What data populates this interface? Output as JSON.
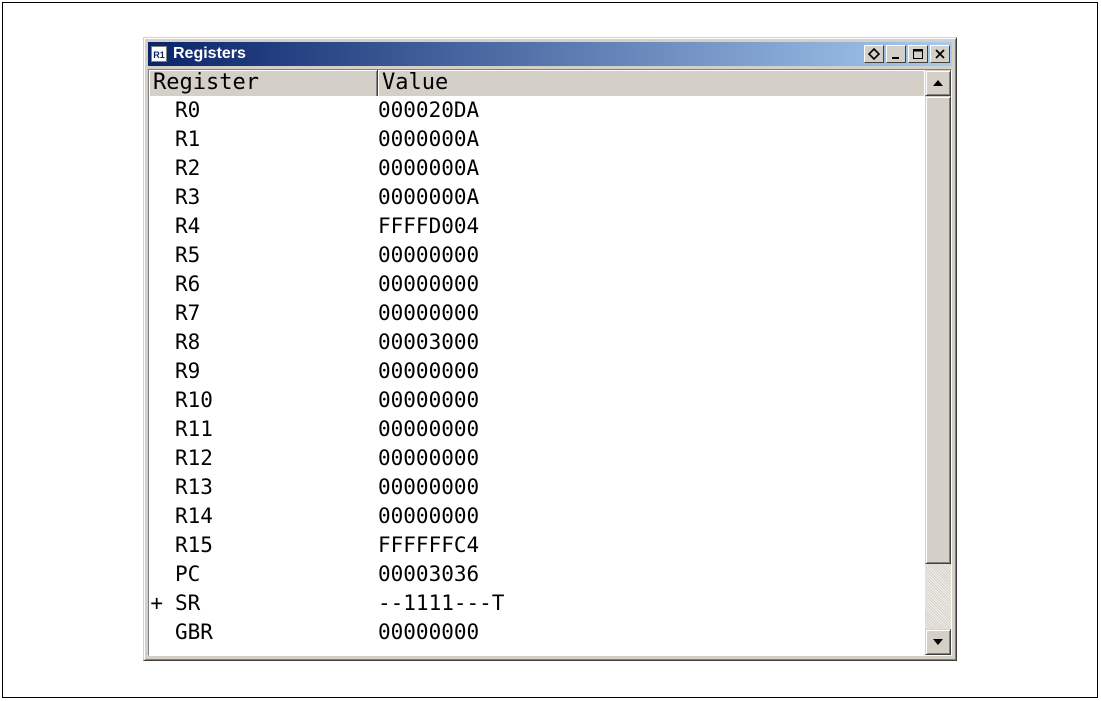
{
  "window": {
    "title": "Registers",
    "icon_label": "R1",
    "buttons": [
      "dock-icon",
      "minimize-icon",
      "maximize-icon",
      "close-icon"
    ]
  },
  "columns": {
    "register": "Register",
    "value": "Value"
  },
  "rows": [
    {
      "expander": "",
      "name": "R0",
      "value": "000020DA"
    },
    {
      "expander": "",
      "name": "R1",
      "value": "0000000A"
    },
    {
      "expander": "",
      "name": "R2",
      "value": "0000000A"
    },
    {
      "expander": "",
      "name": "R3",
      "value": "0000000A"
    },
    {
      "expander": "",
      "name": "R4",
      "value": "FFFFD004"
    },
    {
      "expander": "",
      "name": "R5",
      "value": "00000000"
    },
    {
      "expander": "",
      "name": "R6",
      "value": "00000000"
    },
    {
      "expander": "",
      "name": "R7",
      "value": "00000000"
    },
    {
      "expander": "",
      "name": "R8",
      "value": "00003000"
    },
    {
      "expander": "",
      "name": "R9",
      "value": "00000000"
    },
    {
      "expander": "",
      "name": "R10",
      "value": "00000000"
    },
    {
      "expander": "",
      "name": "R11",
      "value": "00000000"
    },
    {
      "expander": "",
      "name": "R12",
      "value": "00000000"
    },
    {
      "expander": "",
      "name": "R13",
      "value": "00000000"
    },
    {
      "expander": "",
      "name": "R14",
      "value": "00000000"
    },
    {
      "expander": "",
      "name": "R15",
      "value": "FFFFFFC4"
    },
    {
      "expander": "",
      "name": "PC",
      "value": "00003036"
    },
    {
      "expander": "+",
      "name": "SR",
      "value": "--1111---T"
    },
    {
      "expander": "",
      "name": "GBR",
      "value": "00000000"
    }
  ],
  "colors": {
    "titlebar_start": "#0a246a",
    "titlebar_end": "#a6caf0",
    "face": "#d4d0c8"
  }
}
